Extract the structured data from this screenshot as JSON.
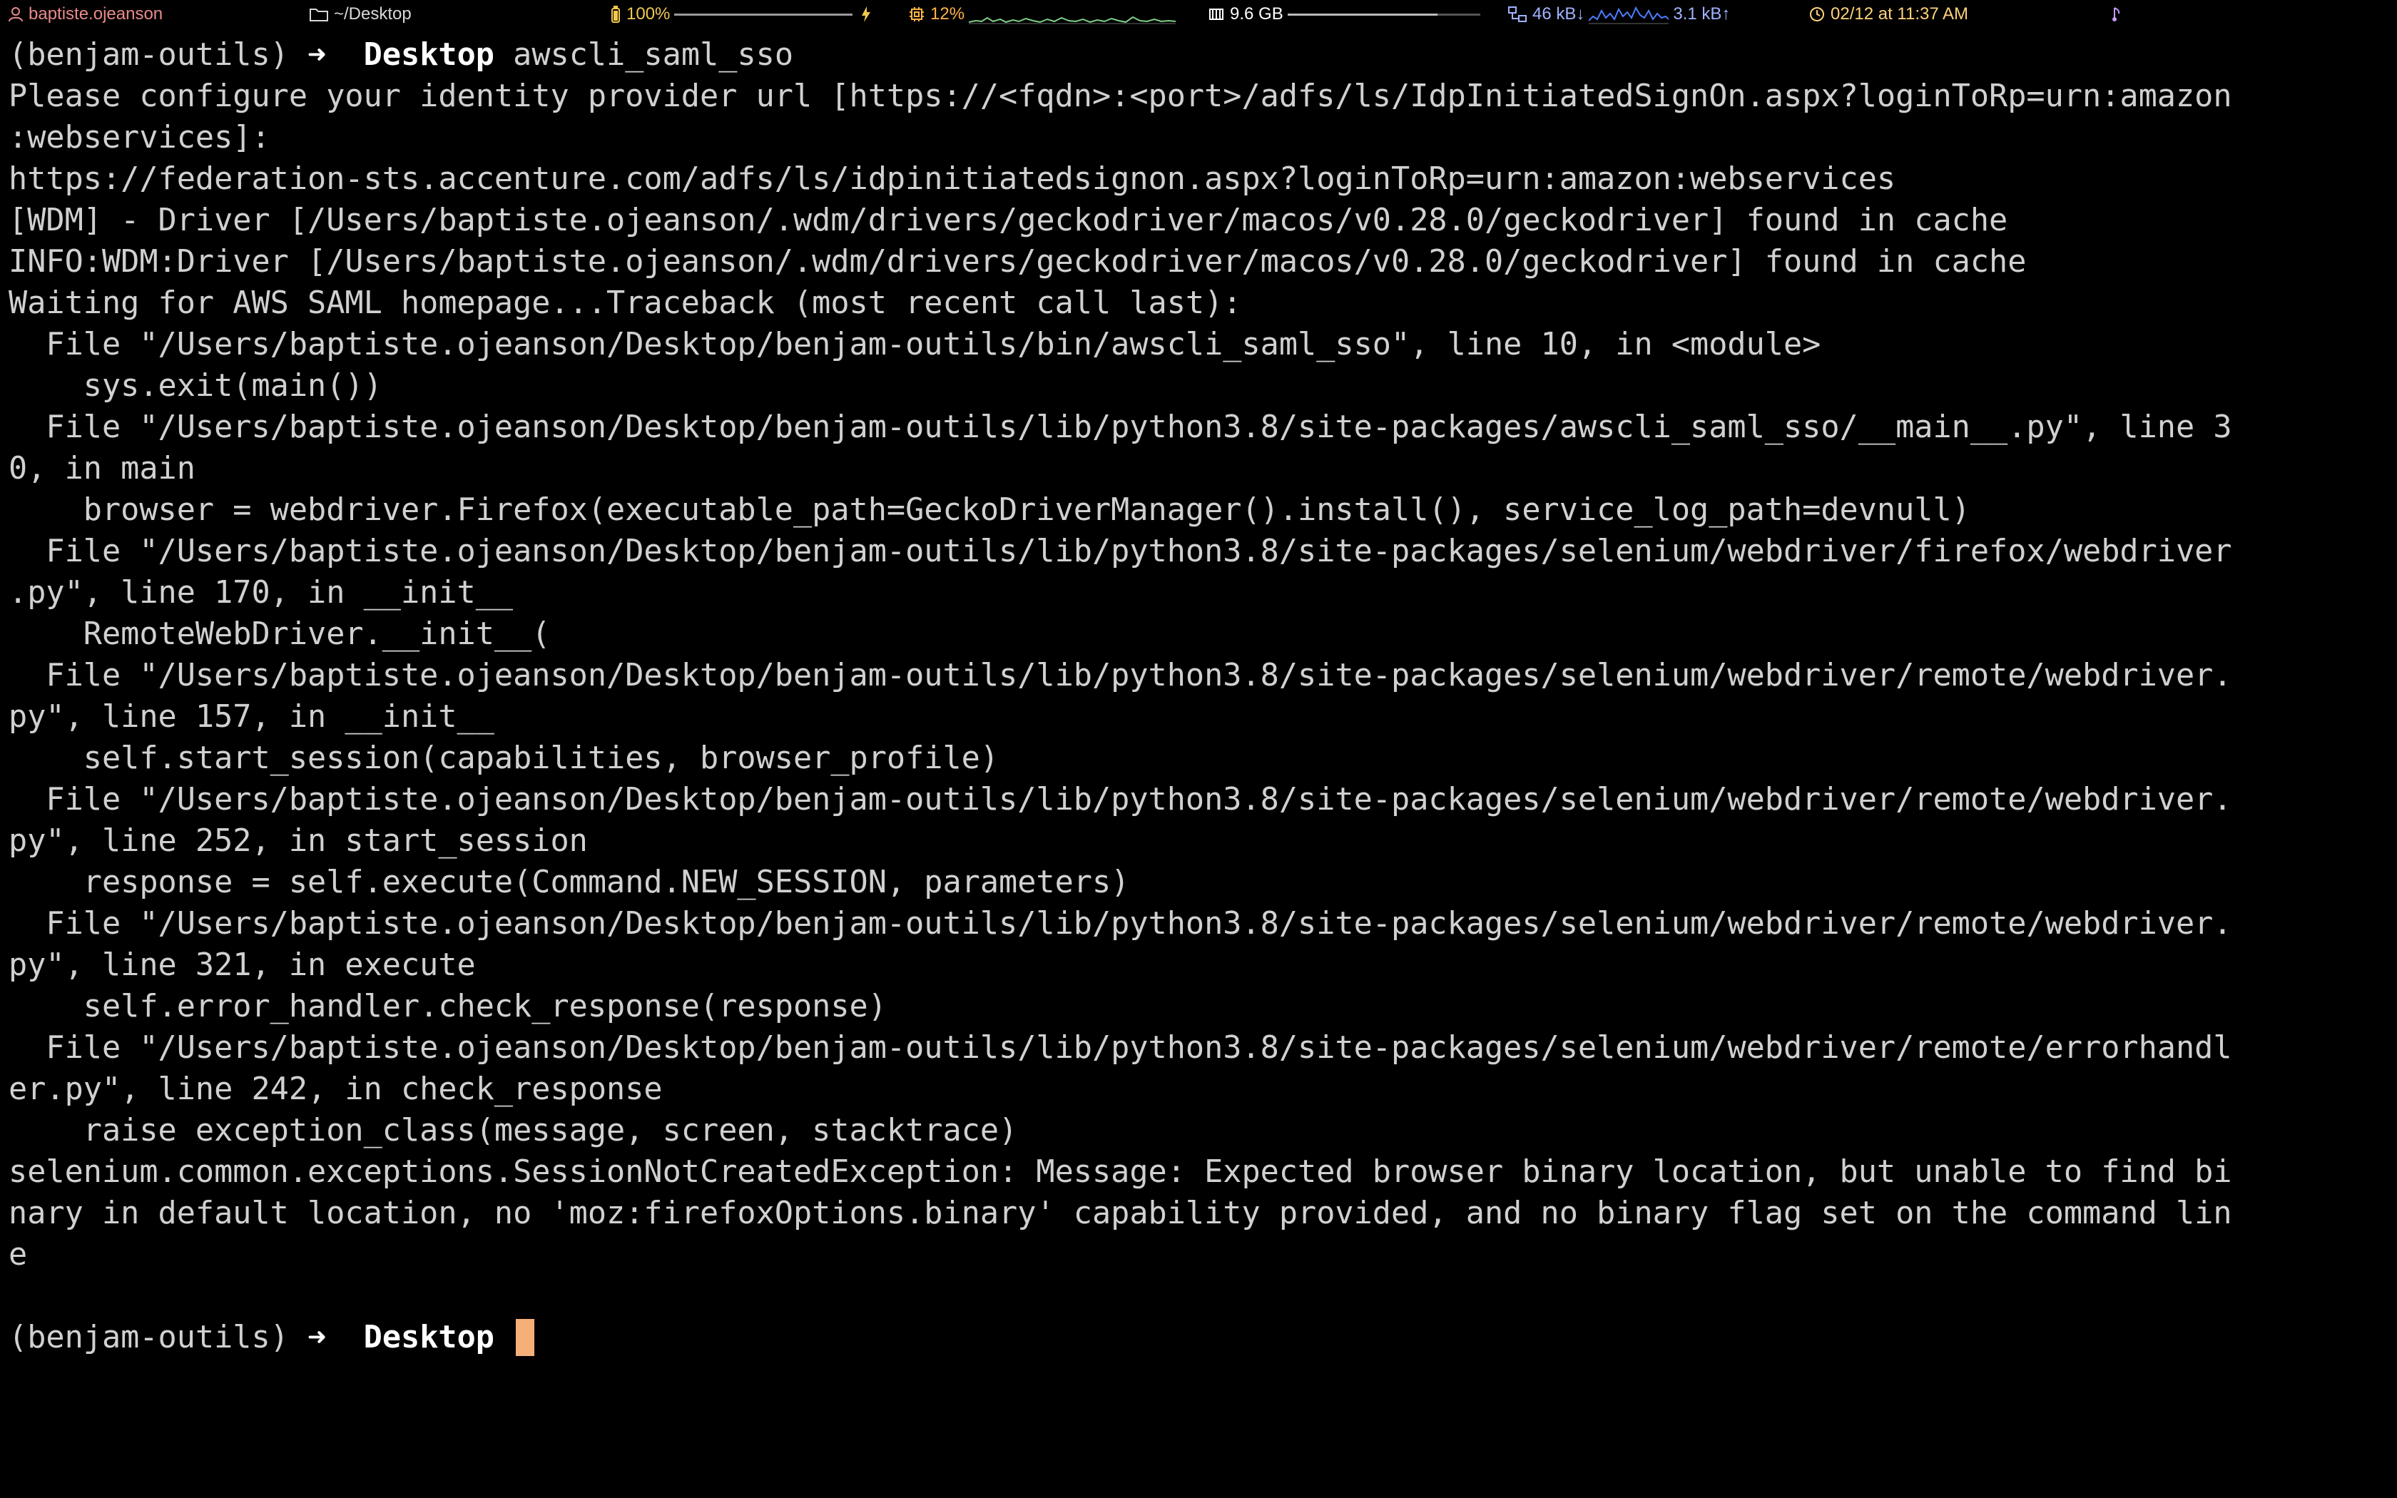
{
  "statusbar": {
    "user": "baptiste.ojeanson",
    "directory": "~/Desktop",
    "battery": "100%",
    "battery_level": 1.0,
    "cpu": "12%",
    "memory": "9.6 GB",
    "net_down": "46 kB↓",
    "net_up": "3.1 kB↑",
    "datetime": "02/12 at 11:37 AM",
    "colors": {
      "user": "#e98a8a",
      "battery": "#f0c850",
      "cpu": "#ffb347",
      "network": "#9fb3ff",
      "datetime": "#ffd27a"
    }
  },
  "terminal": {
    "prompt_venv": "(benjam-outils)",
    "prompt_arrow": "➜",
    "prompt_dir": "Desktop",
    "command": "awscli_saml_sso",
    "output": [
      "Please configure your identity provider url [https://<fqdn>:<port>/adfs/ls/IdpInitiatedSignOn.aspx?loginToRp=urn:amazon",
      ":webservices]:",
      "https://federation-sts.accenture.com/adfs/ls/idpinitiatedsignon.aspx?loginToRp=urn:amazon:webservices",
      "[WDM] - Driver [/Users/baptiste.ojeanson/.wdm/drivers/geckodriver/macos/v0.28.0/geckodriver] found in cache",
      "INFO:WDM:Driver [/Users/baptiste.ojeanson/.wdm/drivers/geckodriver/macos/v0.28.0/geckodriver] found in cache",
      "Waiting for AWS SAML homepage...Traceback (most recent call last):",
      "  File \"/Users/baptiste.ojeanson/Desktop/benjam-outils/bin/awscli_saml_sso\", line 10, in <module>",
      "    sys.exit(main())",
      "  File \"/Users/baptiste.ojeanson/Desktop/benjam-outils/lib/python3.8/site-packages/awscli_saml_sso/__main__.py\", line 3",
      "0, in main",
      "    browser = webdriver.Firefox(executable_path=GeckoDriverManager().install(), service_log_path=devnull)",
      "  File \"/Users/baptiste.ojeanson/Desktop/benjam-outils/lib/python3.8/site-packages/selenium/webdriver/firefox/webdriver",
      ".py\", line 170, in __init__",
      "    RemoteWebDriver.__init__(",
      "  File \"/Users/baptiste.ojeanson/Desktop/benjam-outils/lib/python3.8/site-packages/selenium/webdriver/remote/webdriver.",
      "py\", line 157, in __init__",
      "    self.start_session(capabilities, browser_profile)",
      "  File \"/Users/baptiste.ojeanson/Desktop/benjam-outils/lib/python3.8/site-packages/selenium/webdriver/remote/webdriver.",
      "py\", line 252, in start_session",
      "    response = self.execute(Command.NEW_SESSION, parameters)",
      "  File \"/Users/baptiste.ojeanson/Desktop/benjam-outils/lib/python3.8/site-packages/selenium/webdriver/remote/webdriver.",
      "py\", line 321, in execute",
      "    self.error_handler.check_response(response)",
      "  File \"/Users/baptiste.ojeanson/Desktop/benjam-outils/lib/python3.8/site-packages/selenium/webdriver/remote/errorhandl",
      "er.py\", line 242, in check_response",
      "    raise exception_class(message, screen, stacktrace)",
      "selenium.common.exceptions.SessionNotCreatedException: Message: Expected browser binary location, but unable to find bi",
      "nary in default location, no 'moz:firefoxOptions.binary' capability provided, and no binary flag set on the command lin",
      "e",
      ""
    ],
    "cursor_color": "#f5b07a"
  }
}
